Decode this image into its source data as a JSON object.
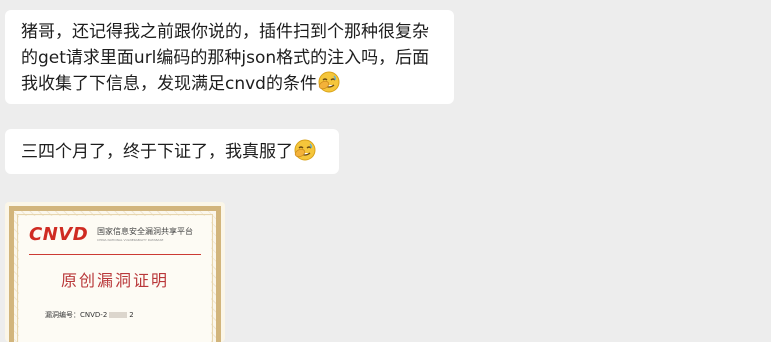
{
  "messages": [
    {
      "lines": [
        "猪哥，还记得我之前跟你说的，插件扫到个那种很复杂",
        "的get请求里面url编码的那种json格式的注入吗，后面",
        "我收集了下信息，发现满足cnvd的条件"
      ],
      "emoji": "facepalm-emoji"
    },
    {
      "lines": [
        "三四个月了，终于下证了，我真服了"
      ],
      "emoji": "facepalm-emoji"
    }
  ],
  "certificate": {
    "logo": "CNVD",
    "org_cn": "国家信息安全漏洞共享平台",
    "org_en": "CHINA NATIONAL VULNERABILITY DATABASE",
    "title": "原创漏洞证明",
    "number_prefix": "漏洞编号：CNVD-2",
    "number_suffix": "2"
  },
  "colors": {
    "background": "#ededed",
    "bubble": "#ffffff",
    "text": "#1d1d1d",
    "cnvd_red": "#cf2b22",
    "cert_border": "#d2b57c"
  }
}
